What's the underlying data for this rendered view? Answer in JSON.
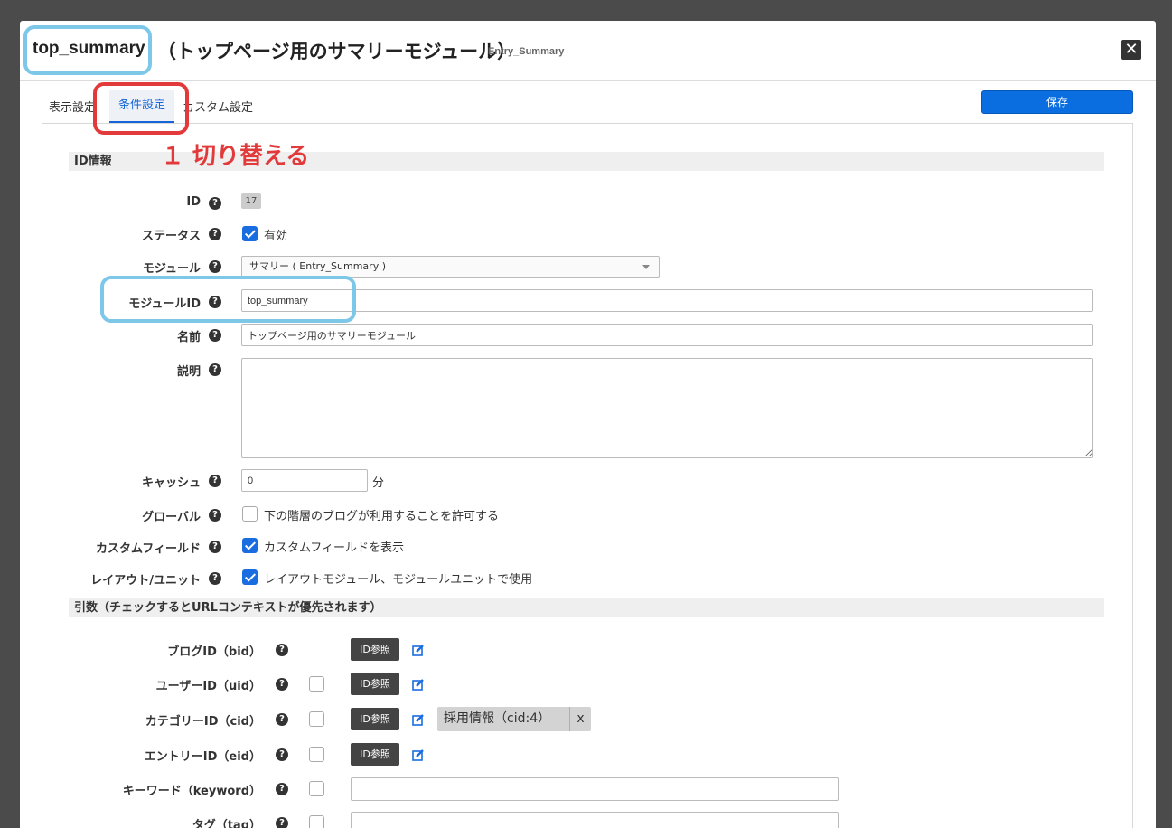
{
  "header": {
    "module_id": "top_summary",
    "module_name": "（トップページ用のサマリーモジュール）",
    "module_type": "Entry_Summary",
    "close_icon": "close-icon"
  },
  "annotation": "１ 切り替える",
  "tabs": [
    {
      "label": "表示設定"
    },
    {
      "label": "条件設定"
    },
    {
      "label": "カスタム設定"
    }
  ],
  "save_label": "保存",
  "sections": {
    "id_info": "ID情報",
    "args": "引数（チェックするとURLコンテキストが優先されます）"
  },
  "help_glyph": "?",
  "fields": {
    "id": {
      "label": "ID",
      "value": "17"
    },
    "status": {
      "label": "ステータス",
      "checkbox_label": "有効",
      "checked": true
    },
    "module": {
      "label": "モジュール",
      "selected": "サマリー ( Entry_Summary )"
    },
    "module_id": {
      "label": "モジュールID",
      "value": "top_summary"
    },
    "name": {
      "label": "名前",
      "value": "トップページ用のサマリーモジュール"
    },
    "description": {
      "label": "説明",
      "value": ""
    },
    "cache": {
      "label": "キャッシュ",
      "value": "0",
      "unit": "分"
    },
    "global": {
      "label": "グローバル",
      "checkbox_label": "下の階層のブログが利用することを許可する",
      "checked": false
    },
    "custom_field": {
      "label": "カスタムフィールド",
      "checkbox_label": "カスタムフィールドを表示",
      "checked": true
    },
    "layout_unit": {
      "label": "レイアウト/ユニット",
      "checkbox_label": "レイアウトモジュール、モジュールユニットで使用",
      "checked": true
    }
  },
  "args": {
    "id_ref_label": "ID参照",
    "bid": {
      "label": "ブログID（bid）"
    },
    "uid": {
      "label": "ユーザーID（uid）",
      "checked": false
    },
    "cid": {
      "label": "カテゴリーID（cid）",
      "checked": false,
      "chip": "採用情報（cid:4）",
      "chip_remove": "x"
    },
    "eid": {
      "label": "エントリーID（eid）",
      "checked": false
    },
    "keyword": {
      "label": "キーワード（keyword）",
      "checked": false,
      "value": ""
    },
    "tag": {
      "label": "タグ（tag）",
      "checked": false,
      "value": ""
    }
  },
  "colors": {
    "accent": "#0a6ee0",
    "highlight_blue": "#7dc7e8",
    "highlight_red": "#e23a3a"
  }
}
